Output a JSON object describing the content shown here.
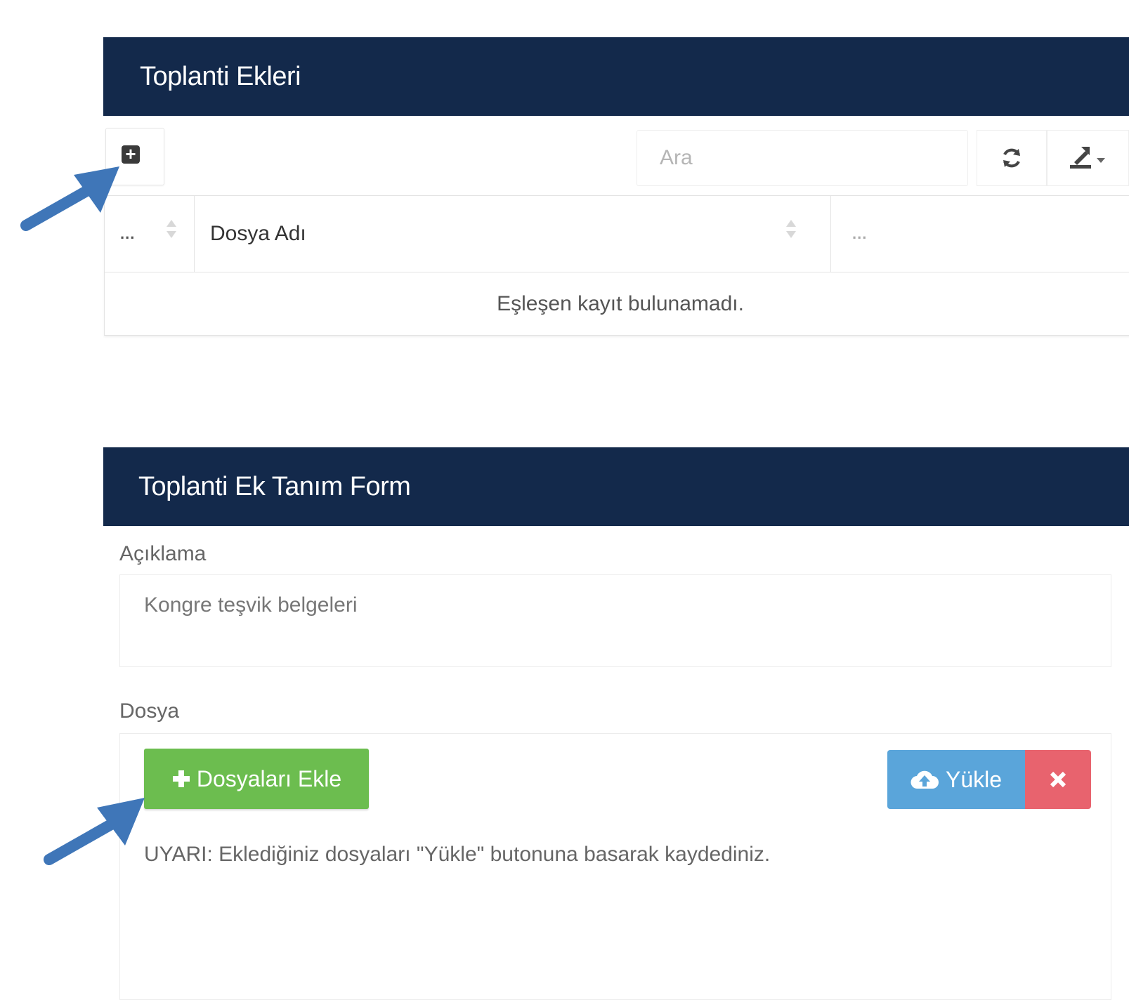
{
  "attachments_panel": {
    "title": "Toplanti Ekleri",
    "add_icon": "plus-square-icon",
    "search": {
      "placeholder": "Ara"
    },
    "refresh_icon": "refresh-icon",
    "export_icon": "export-icon",
    "table": {
      "columns": [
        "...",
        "Dosya Adı",
        "..."
      ],
      "empty_message": "Eşleşen kayıt bulunamadı."
    }
  },
  "form_panel": {
    "title": "Toplanti Ek Tanım Form",
    "description_label": "Açıklama",
    "description_value": "Kongre teşvik belgeleri",
    "file_label": "Dosya",
    "add_files_label": "Dosyaları Ekle",
    "upload_label": "Yükle",
    "warning_text": "UYARI: Eklediğiniz dosyaları \"Yükle\" butonuna basarak kaydediniz."
  },
  "colors": {
    "header_bg": "#13294b",
    "add_files_green": "#6cbd4f",
    "upload_blue": "#5aa5da",
    "cancel_red": "#e8636e",
    "annotation_arrow": "#3f76b8"
  }
}
